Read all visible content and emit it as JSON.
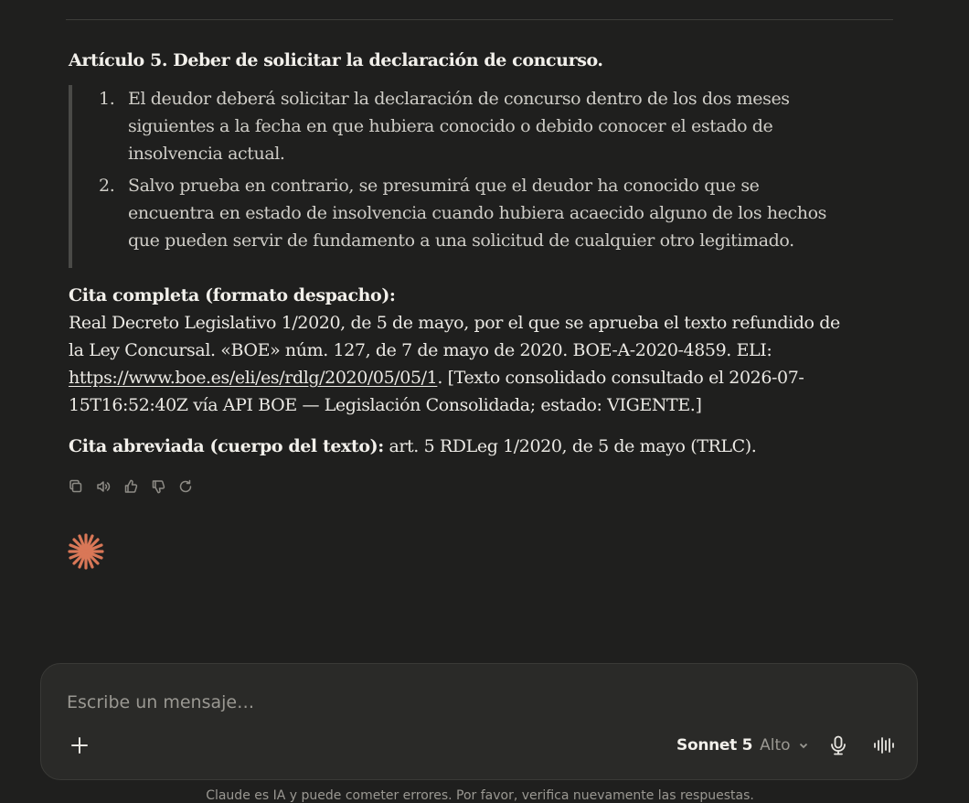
{
  "article": {
    "heading": "Artículo 5. Deber de solicitar la declaración de concurso.",
    "items": [
      {
        "num": "1.",
        "text": "El deudor deberá solicitar la declaración de concurso dentro de los dos meses siguientes a la fecha en que hubiera conocido o debido conocer el estado de insolvencia actual."
      },
      {
        "num": "2.",
        "text": "Salvo prueba en contrario, se presumirá que el deudor ha conocido que se encuentra en estado de insolvencia cuando hubiera acaecido alguno de los hechos que pueden servir de fundamento a una solicitud de cualquier otro legitimado."
      }
    ]
  },
  "citation_full": {
    "label": "Cita completa (formato despacho):",
    "text_before": "Real Decreto Legislativo 1/2020, de 5 de mayo, por el que se aprueba el texto refundido de la Ley Concursal. «BOE» núm. 127, de 7 de mayo de 2020. BOE-A-2020-4859. ELI: ",
    "link": "https://www.boe.es/eli/es/rdlg/2020/05/05/1",
    "text_after": ". [Texto consolidado consultado el 2026-07-15T16:52:40Z vía API BOE — Legislación Consolidada; estado: VIGENTE.]"
  },
  "citation_short": {
    "label": "Cita abreviada (cuerpo del texto):",
    "text": " art. 5 RDLeg 1/2020, de 5 de mayo (TRLC)."
  },
  "actions": {
    "icons": [
      "copy-icon",
      "speaker-icon",
      "thumbs-up-icon",
      "thumbs-down-icon",
      "retry-icon"
    ]
  },
  "composer": {
    "placeholder": "Escribe un mensaje…",
    "model": "Sonnet 5",
    "level": "Alto"
  },
  "disclaimer": "Claude es IA y puede cometer errores. Por favor, verifica nuevamente las respuestas.",
  "colors": {
    "background": "#1f1f1e",
    "accent": "#d97757",
    "composer": "#2a2a28"
  }
}
